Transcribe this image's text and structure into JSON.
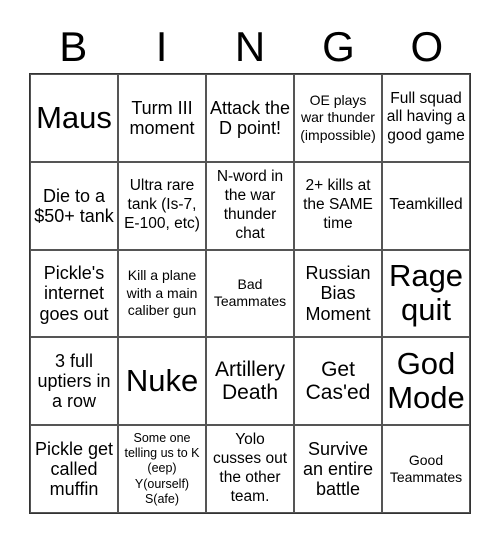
{
  "header": {
    "letters": [
      "B",
      "I",
      "N",
      "G",
      "O"
    ]
  },
  "cells": [
    "Maus",
    "Turm III moment",
    "Attack the D point!",
    "OE plays war thunder (impossible)",
    "Full squad all having a good game",
    "Die to a $50+ tank",
    "Ultra rare tank (Is-7, E-100, etc)",
    "N-word in the war thunder chat",
    "2+ kills at the SAME time",
    "Teamkilled",
    "Pickle's internet goes out",
    "Kill a plane with a main caliber gun",
    "Bad Teammates",
    "Russian Bias Moment",
    "Rage quit",
    "3 full uptiers in a row",
    "Nuke",
    "Artillery Death",
    "Get Cas'ed",
    "God Mode",
    "Pickle get called muffin",
    "Some one telling us to K (eep) Y(ourself) S(afe)",
    "Yolo cusses out the other team.",
    "Survive an entire battle",
    "Good Teammates"
  ]
}
